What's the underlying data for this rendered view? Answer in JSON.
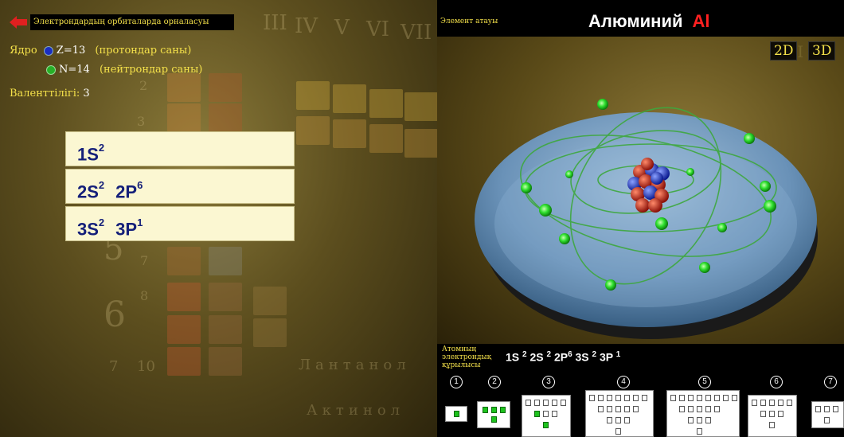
{
  "left_panel": {
    "title": "Электрондардың орбиталарда орналасуы",
    "nucleus_label": "Ядро",
    "protons": "Z=13",
    "protons_note": "(протондар саны)",
    "neutrons": "N=14",
    "neutrons_note": "(нейтрондар саны)",
    "valence_label": "Валенттілігі:",
    "valence_value": "3",
    "shells": [
      {
        "s_label": "1S",
        "s_sup": "2",
        "p_label": "",
        "p_sup": ""
      },
      {
        "s_label": "2S",
        "s_sup": "2",
        "p_label": "2P",
        "p_sup": "6"
      },
      {
        "s_label": "3S",
        "s_sup": "2",
        "p_label": "3P",
        "p_sup": "1"
      }
    ],
    "background_row_numbers": [
      "2",
      "3",
      "5",
      "6",
      "7",
      "8",
      "6",
      "7",
      "10"
    ],
    "background_group_numerals": [
      "III",
      "IV",
      "V",
      "VI",
      "VII",
      "VIII"
    ],
    "background_words": [
      "Лантанол",
      "Актинол"
    ]
  },
  "right_panel": {
    "element_label": "Элемент атауы",
    "element_name": "Алюминий",
    "element_symbol": "Al",
    "view_2d": "2D",
    "view_3d": "3D",
    "config_label": "Атомның электрондық құрылысы",
    "config_parts": [
      {
        "t": "1S",
        "s": "2"
      },
      {
        "t": "2S",
        "s": "2"
      },
      {
        "t": "2P",
        "s": "6"
      },
      {
        "t": "3S",
        "s": "2"
      },
      {
        "t": "3P",
        "s": "1"
      }
    ],
    "shell_numbers": [
      "1",
      "2",
      "3",
      "4",
      "5",
      "6",
      "7"
    ]
  },
  "colors": {
    "accent_yellow": "#f4e14a",
    "config_text": "#15207a",
    "symbol_red": "#ff2020",
    "electron_green": "#1ec21e",
    "proton_blue": "#1a2ec0",
    "neutron_green": "#28b028"
  }
}
